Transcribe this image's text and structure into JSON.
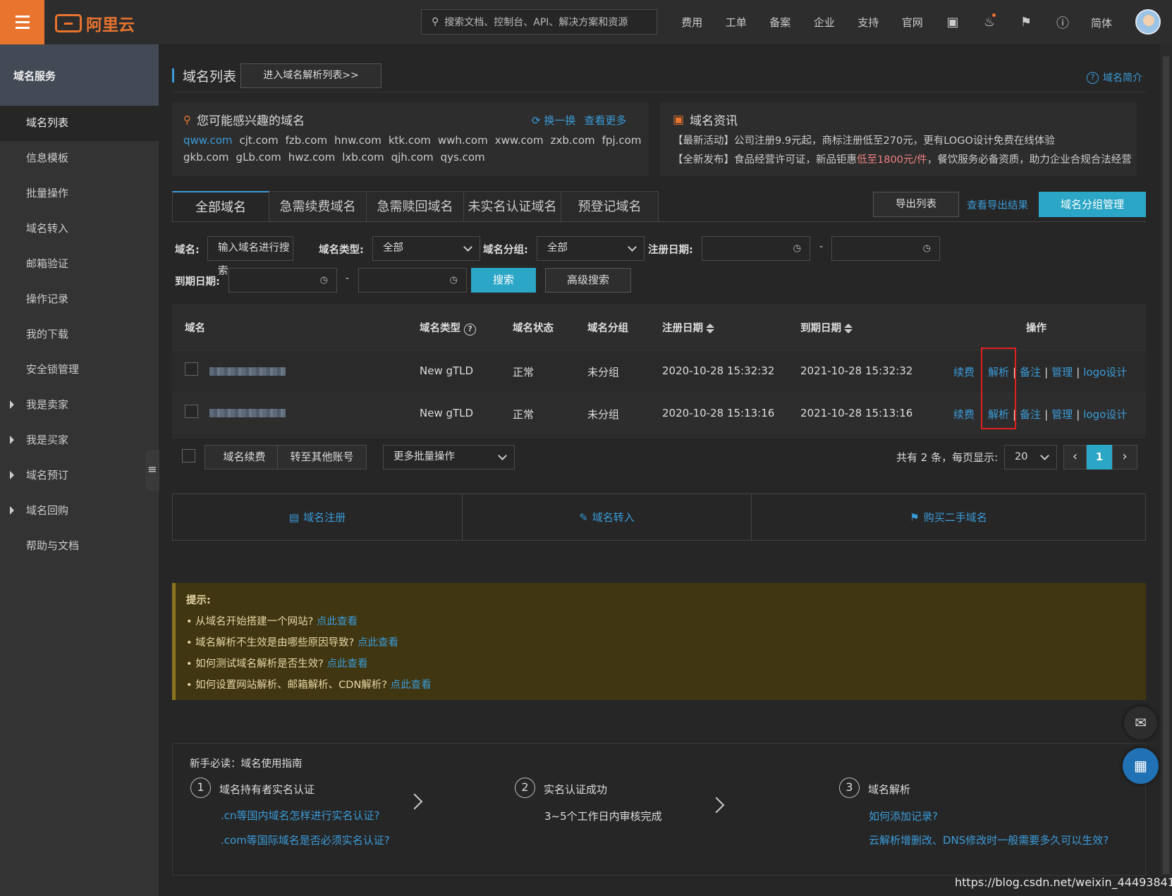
{
  "header": {
    "logo_text": "阿里云",
    "search_placeholder": "搜索文档、控制台、API、解决方案和资源",
    "nav": [
      "费用",
      "工单",
      "备案",
      "企业",
      "支持",
      "官网"
    ],
    "icons": [
      "terminal-icon",
      "bell-icon",
      "cart-icon",
      "help-icon"
    ],
    "lang": "简体",
    "brand_color": "#e8742e"
  },
  "sidebar": {
    "title": "域名服务",
    "items": [
      {
        "label": "域名列表",
        "active": true
      },
      {
        "label": "信息模板"
      },
      {
        "label": "批量操作"
      },
      {
        "label": "域名转入"
      },
      {
        "label": "邮箱验证"
      },
      {
        "label": "操作记录"
      },
      {
        "label": "我的下载"
      },
      {
        "label": "安全锁管理"
      },
      {
        "label": "我是卖家",
        "expandable": true
      },
      {
        "label": "我是买家",
        "expandable": true
      },
      {
        "label": "域名预订",
        "expandable": true
      },
      {
        "label": "域名回购",
        "expandable": true
      },
      {
        "label": "帮助与文档"
      }
    ]
  },
  "page": {
    "title": "域名列表",
    "goto_button": "进入域名解析列表>>",
    "intro_link": "域名简介"
  },
  "suggest": {
    "title": "您可能感兴趣的域名",
    "refresh": "换一换",
    "more": "查看更多",
    "row1": [
      "qww.com",
      "cjt.com",
      "fzb.com",
      "hnw.com",
      "ktk.com",
      "wwh.com",
      "xww.com",
      "zxb.com",
      "fpj.com"
    ],
    "row2": [
      "gkb.com",
      "gLb.com",
      "hwz.com",
      "lxb.com",
      "qjh.com",
      "qys.com"
    ]
  },
  "news": {
    "title": "域名资讯",
    "line1": "【最新活动】公司注册9.9元起，商标注册低至270元，更有LOGO设计免费在线体验",
    "line2_a": "【全新发布】食品经营许可证，新品钜惠",
    "line2_b": "低至1800元/件",
    "line2_c": "，餐饮服务必备资质，助力企业合规合法经营"
  },
  "tabs": [
    "全部域名",
    "急需续费域名",
    "急需赎回域名",
    "未实名认证域名",
    "预登记域名"
  ],
  "toolbar": {
    "export": "导出列表",
    "export_result": "查看导出结果",
    "group_manage": "域名分组管理"
  },
  "filters": {
    "domain_label": "域名:",
    "domain_btn": "输入域名进行搜索",
    "type_label": "域名类型:",
    "type_value": "全部",
    "group_label": "域名分组:",
    "group_value": "全部",
    "reg_label": "注册日期:",
    "exp_label": "到期日期:",
    "dash": "-",
    "search": "搜索",
    "advanced": "高级搜索"
  },
  "table": {
    "headers": {
      "domain": "域名",
      "type": "域名类型",
      "status": "域名状态",
      "group": "域名分组",
      "reg": "注册日期",
      "exp": "到期日期",
      "ops": "操作"
    },
    "rows": [
      {
        "type": "New gTLD",
        "status": "正常",
        "group": "未分组",
        "reg": "2020-10-28 15:32:32",
        "exp": "2021-10-28 15:32:32"
      },
      {
        "type": "New gTLD",
        "status": "正常",
        "group": "未分组",
        "reg": "2020-10-28 15:13:16",
        "exp": "2021-10-28 15:13:16"
      }
    ],
    "ops": {
      "renew": "续费",
      "resolve": "解析",
      "note": "备注",
      "manage": "管理",
      "logo": "logo设计",
      "sep": "|"
    }
  },
  "footer": {
    "renew": "域名续费",
    "transfer": "转至其他账号",
    "batch": "更多批量操作",
    "total": "共有 2 条，每页显示:",
    "page_size": "20",
    "page": "1",
    "prev": "‹",
    "next": "›"
  },
  "actions": [
    "域名注册",
    "域名转入",
    "购买二手域名"
  ],
  "tips": {
    "title": "提示:",
    "items": [
      {
        "text": "• 从域名开始搭建一个网站?",
        "link": "点此查看"
      },
      {
        "text": "• 域名解析不生效是由哪些原因导致?",
        "link": "点此查看"
      },
      {
        "text": "• 如何测试域名解析是否生效?",
        "link": "点此查看"
      },
      {
        "text": "• 如何设置网站解析、邮箱解析、CDN解析?",
        "link": "点此查看"
      }
    ]
  },
  "guide": {
    "title": "新手必读：域名使用指南",
    "steps": [
      {
        "num": "1",
        "title": "域名持有者实名认证",
        "links": [
          ".cn等国内域名怎样进行实名认证?",
          ".com等国际域名是否必须实名认证?"
        ]
      },
      {
        "num": "2",
        "title": "实名认证成功",
        "links": [
          "3~5个工作日内审核完成"
        ]
      },
      {
        "num": "3",
        "title": "域名解析",
        "links": [
          "如何添加记录?",
          "云解析增删改、DNS修改时一般需要多久可以生效?"
        ]
      }
    ]
  },
  "watermark": "https://blog.csdn.net/weixin_44493841",
  "colors": {
    "accent": "#2ba6c6",
    "link": "#3b9bd8",
    "highlight": "#e02020"
  }
}
